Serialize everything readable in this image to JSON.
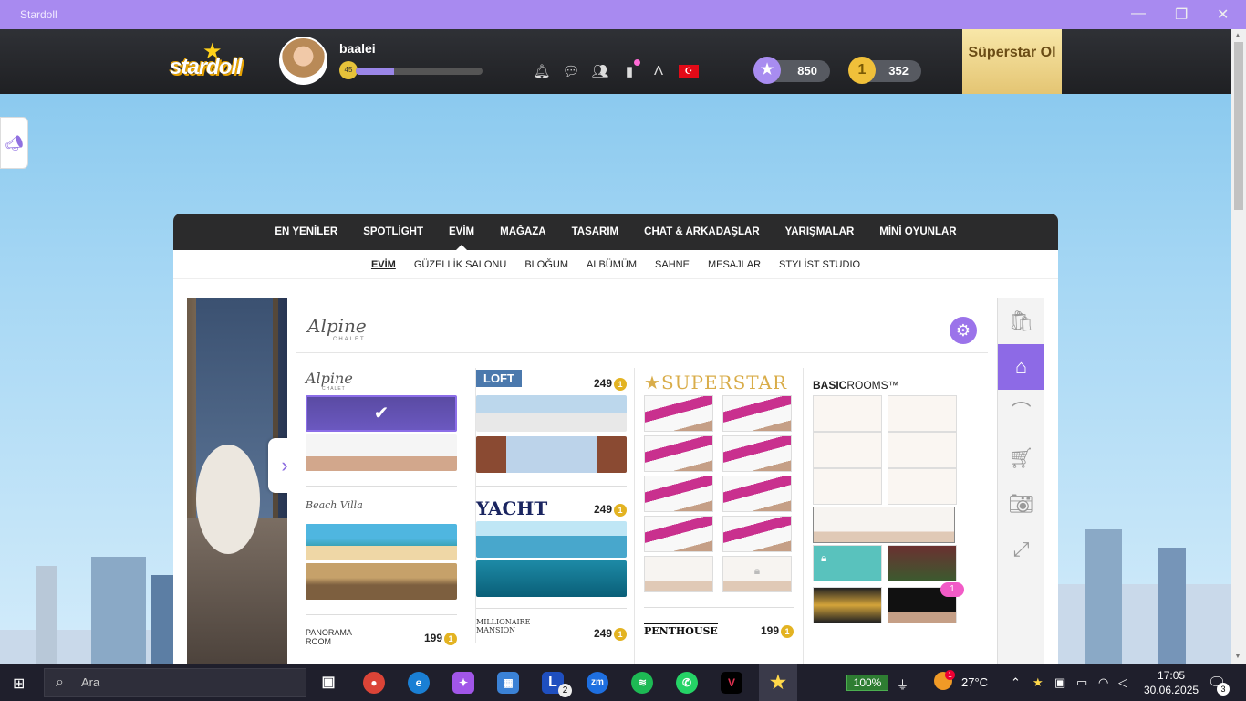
{
  "window": {
    "title": "Stardoll"
  },
  "header": {
    "logo_text": "stardoll",
    "username": "baalei",
    "level": "45",
    "xp_fraction": 0.3,
    "stardollars": "850",
    "coins": "352",
    "superstar_label": "Süperstar Ol",
    "icons": [
      "bell-icon",
      "chat-icon",
      "friends-icon",
      "bookmark-icon",
      "brand-icon",
      "turkey-flag-icon"
    ]
  },
  "nav_primary": [
    "EN YENİLER",
    "SPOTLİGHT",
    "EVİM",
    "MAĞAZA",
    "TASARIM",
    "CHAT & ARKADAŞLAR",
    "YARIŞMALAR",
    "MİNİ OYUNLAR"
  ],
  "nav_primary_active": "EVİM",
  "nav_secondary": [
    "EVİM",
    "GÜZELLİK SALONU",
    "BLOĞUM",
    "ALBÜMÜM",
    "SAHNE",
    "MESAJLAR",
    "STYLİST STUDIO"
  ],
  "nav_secondary_active": "EVİM",
  "rooms": {
    "current_brand": "Alpine",
    "current_brand_sub": "CHALET",
    "col1": [
      {
        "brand": "Alpine",
        "sub": "CHALET",
        "price": ""
      },
      {
        "brand": "Beach Villa",
        "sub": "",
        "price": ""
      },
      {
        "brand": "PANORAMA ROOM",
        "sub": "",
        "price": "199"
      }
    ],
    "col2": [
      {
        "brand": "LOFT",
        "price": "249"
      },
      {
        "brand": "YACHT",
        "price": "249"
      },
      {
        "brand": "MILLIONAIRE MANSION",
        "price": "249"
      }
    ],
    "col3": [
      {
        "brand": "SUPERSTAR",
        "price": ""
      },
      {
        "brand": "PENTHOUSE",
        "price": "199"
      }
    ],
    "col4": [
      {
        "brand_bold": "BASIC",
        "brand_thin": "ROOMS™",
        "badge": "1"
      }
    ]
  },
  "toolbar_icons": [
    "shopping-bag-icon",
    "home-icon",
    "hanger-icon",
    "cart-icon",
    "camera-icon",
    "fullscreen-icon"
  ],
  "taskbar": {
    "search_placeholder": "Ara",
    "battery": "100%",
    "temperature": "27°C",
    "time": "17:05",
    "date": "30.06.2025",
    "notifications": "3",
    "l_badge": "2",
    "weather_badge": "1"
  }
}
